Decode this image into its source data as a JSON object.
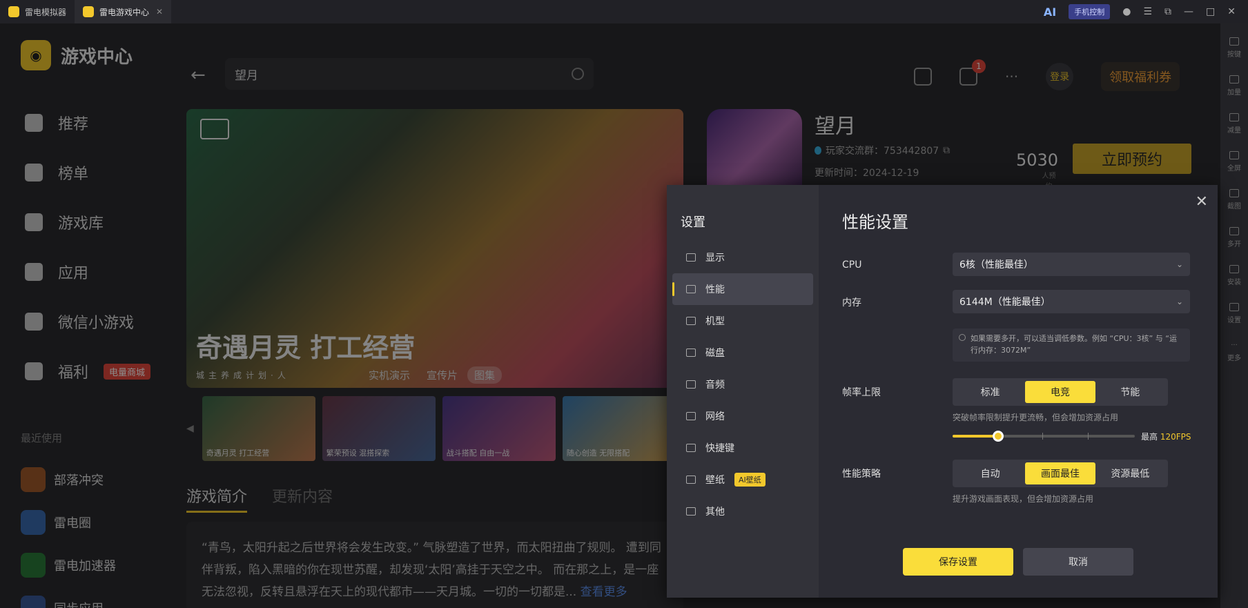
{
  "window": {
    "tabs": [
      {
        "label": "雷电模拟器"
      },
      {
        "label": "雷电游戏中心"
      }
    ],
    "phone_control": "手机控制",
    "ai_label": "AI"
  },
  "side_tools": [
    "按键",
    "加量",
    "减量",
    "全屏",
    "截图",
    "多开",
    "安装",
    "设置",
    "更多"
  ],
  "app": {
    "title": "游戏中心",
    "nav": [
      {
        "label": "推荐"
      },
      {
        "label": "榜单"
      },
      {
        "label": "游戏库"
      },
      {
        "label": "应用"
      },
      {
        "label": "微信小游戏"
      },
      {
        "label": "福利",
        "badge": "电量商城"
      }
    ],
    "recent_title": "最近使用",
    "recent": [
      {
        "label": "部落冲突"
      },
      {
        "label": "雷电圈"
      },
      {
        "label": "雷电加速器"
      },
      {
        "label": "同步应用"
      }
    ],
    "search_value": "望月",
    "download_badge": "1",
    "login": "登录",
    "welfare": "领取福利券"
  },
  "game": {
    "title": "望月",
    "community": "玩家交流群：753442807",
    "updated": "更新时间：2024-12-19",
    "count": "5030",
    "count_label": "人预约",
    "reserve": "立即预约",
    "banner_title": "奇遇月灵 打工经营",
    "banner_sub": "城主养成计划·人",
    "banner_tabs": [
      "实机演示",
      "宣传片",
      "图集"
    ],
    "thumbs": [
      "奇遇月灵 打工经营",
      "繁荣预设 混搭探索",
      "战斗搭配 自由一战",
      "随心创造 无限搭配"
    ],
    "section_tabs": [
      "游戏简介",
      "更新内容"
    ],
    "description": "“青鸟，太阳升起之后世界将会发生改变。” 气脉塑造了世界，而太阳扭曲了规则。 遭到同伴背叛，陷入黑暗的你在现世苏醒，却发现‘太阳’高挂于天空之中。 而在那之上，是一座无法忽视，反转且悬浮在天上的现代都市——天月城。一切的一切都是...",
    "more": "查看更多"
  },
  "settings": {
    "side_title": "设置",
    "menu": [
      {
        "label": "显示"
      },
      {
        "label": "性能"
      },
      {
        "label": "机型"
      },
      {
        "label": "磁盘"
      },
      {
        "label": "音频"
      },
      {
        "label": "网络"
      },
      {
        "label": "快捷键"
      },
      {
        "label": "壁纸",
        "badge": "AI壁纸"
      },
      {
        "label": "其他"
      }
    ],
    "title": "性能设置",
    "cpu_label": "CPU",
    "cpu_value": "6核（性能最佳）",
    "memory_label": "内存",
    "memory_value": "6144M（性能最佳）",
    "tip": "如果需要多开，可以适当调低参数。例如 “CPU：3核” 与 “运行内存：3072M”",
    "fps_label": "帧率上限",
    "fps_options": [
      "标准",
      "电竞",
      "节能"
    ],
    "fps_selected": "电竞",
    "fps_note": "突破帧率限制提升更流畅，但会增加资源占用",
    "fps_max_label": "最高",
    "fps_max_value": "120FPS",
    "fps_level": 0.25,
    "strategy_label": "性能策略",
    "strategy_options": [
      "自动",
      "画面最佳",
      "资源最低"
    ],
    "strategy_selected": "画面最佳",
    "strategy_note": "提升游戏画面表现，但会增加资源占用",
    "save": "保存设置",
    "cancel": "取消"
  }
}
